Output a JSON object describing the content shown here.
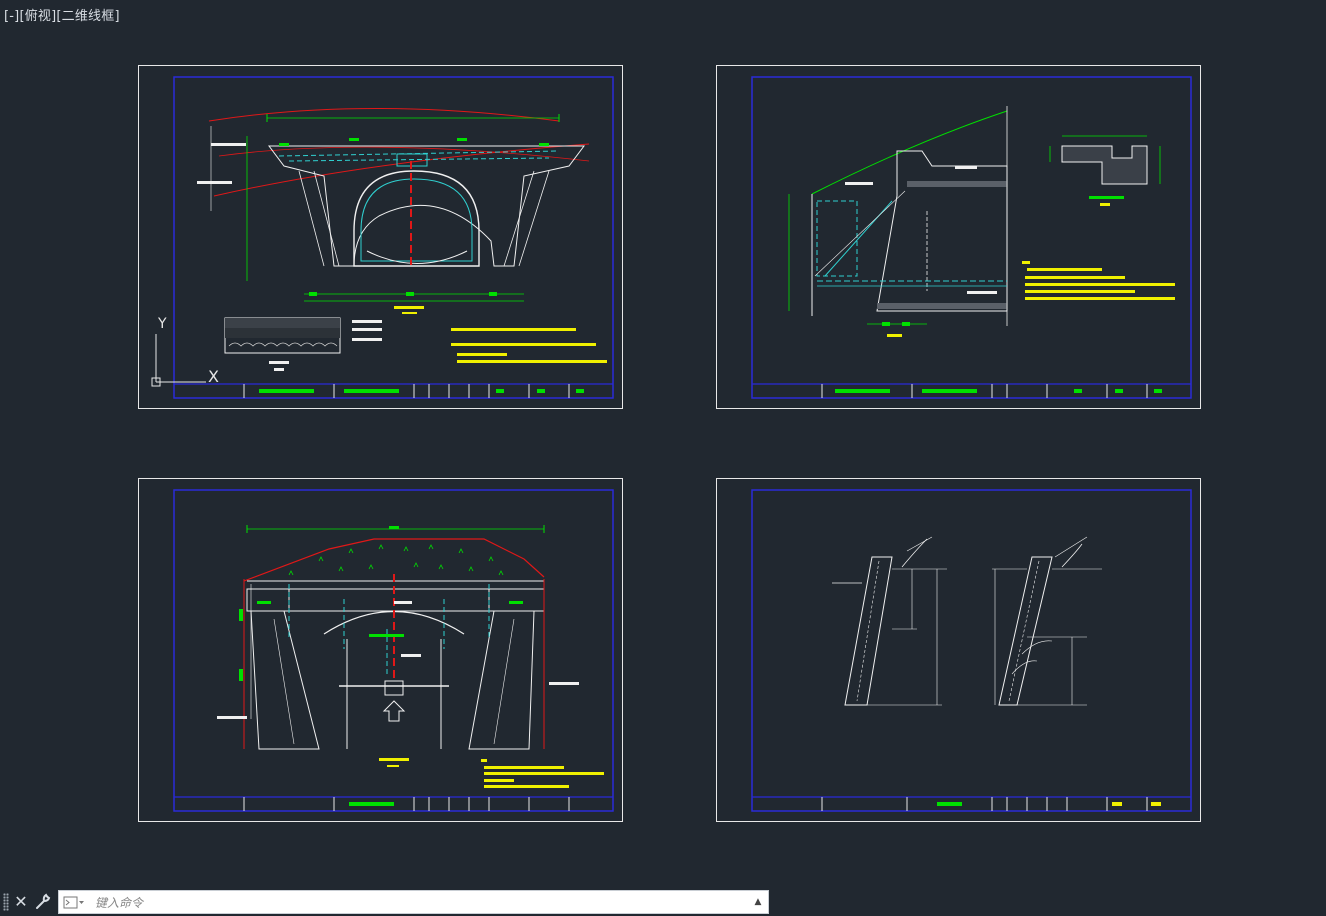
{
  "viewport": {
    "controls": [
      "[-]",
      "[俯视]",
      "[二维线框]"
    ]
  },
  "ucs": {
    "x_label": "X",
    "y_label": "Y"
  },
  "command": {
    "placeholder": "键入命令",
    "close_symbol": "✕",
    "history_symbol": "▲"
  },
  "colors": {
    "background": "#212830",
    "sheet_border": "#e8e8e8",
    "frame": "#2a2ad8",
    "green": "#00e000",
    "cyan": "#30d0d0",
    "red": "#e01818",
    "yellow": "#f0f000",
    "white": "#f0f0f0"
  },
  "sheets": [
    {
      "id": "sheet-1",
      "drawing": "portal-front-elevation"
    },
    {
      "id": "sheet-2",
      "drawing": "portal-side-section"
    },
    {
      "id": "sheet-3",
      "drawing": "portal-front-view-2"
    },
    {
      "id": "sheet-4",
      "drawing": "slope-details"
    }
  ]
}
